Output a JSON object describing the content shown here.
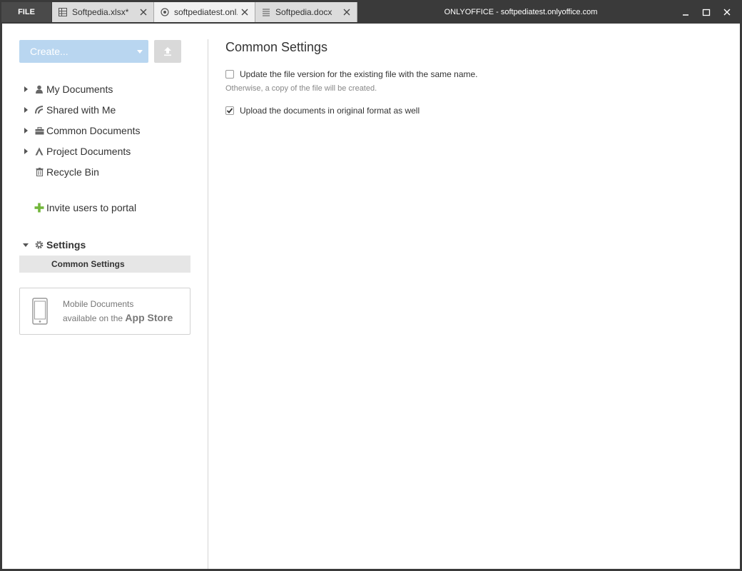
{
  "titlebar": {
    "file_label": "FILE",
    "window_title": "ONLYOFFICE - softpediatest.onlyoffice.com",
    "tabs": [
      {
        "label": "Softpedia.xlsx*",
        "icon": "spreadsheet-icon"
      },
      {
        "label": "softpediatest.onl...",
        "icon": "portal-icon"
      },
      {
        "label": "Softpedia.docx",
        "icon": "document-icon"
      }
    ]
  },
  "sidebar": {
    "create_label": "Create...",
    "folders": [
      {
        "label": "My Documents",
        "icon": "user-icon"
      },
      {
        "label": "Shared with Me",
        "icon": "share-icon"
      },
      {
        "label": "Common Documents",
        "icon": "briefcase-icon"
      },
      {
        "label": "Project Documents",
        "icon": "project-icon"
      },
      {
        "label": "Recycle Bin",
        "icon": "trash-icon"
      }
    ],
    "invite_label": "Invite users to portal",
    "settings_label": "Settings",
    "settings_sub_label": "Common Settings",
    "promo": {
      "line1": "Mobile Documents",
      "line2_prefix": "available on the ",
      "line2_store": "App Store"
    }
  },
  "content": {
    "heading": "Common Settings",
    "option1_label": "Update the file version for the existing file with the same name.",
    "option1_hint": "Otherwise, a copy of the file will be created.",
    "option1_checked": false,
    "option2_label": "Upload the documents in original format as well",
    "option2_checked": true
  },
  "colors": {
    "titlebar": "#3a3a3a",
    "create_button": "#b9d6f0",
    "invite_plus": "#72b63b"
  }
}
